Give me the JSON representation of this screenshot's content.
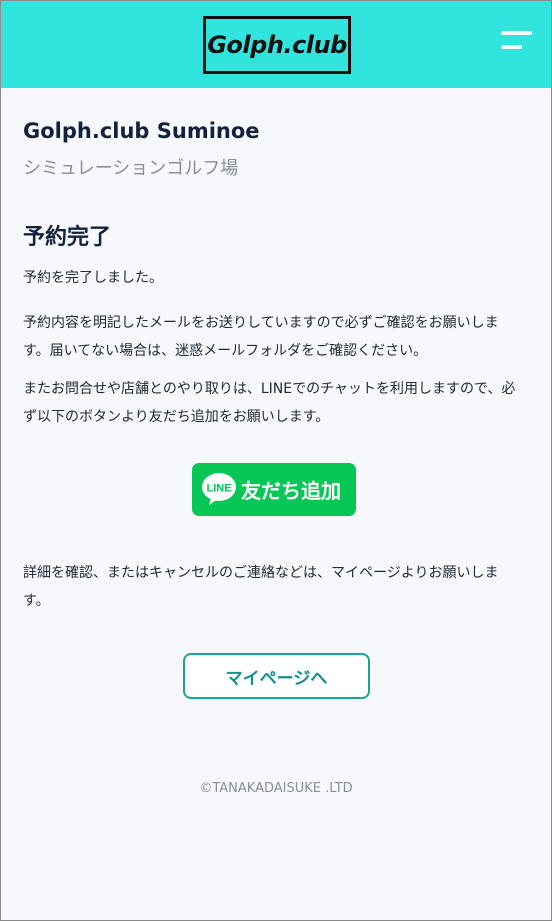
{
  "header": {
    "logo_text": "Golph.club",
    "menu_icon": "hamburger-menu-icon",
    "background_color": "#32e4de"
  },
  "store": {
    "name": "Golph.club Suminoe",
    "type": "シミュレーションゴルフ場"
  },
  "main": {
    "heading": "予約完了",
    "paragraph1": "予約を完了しました。",
    "paragraph2": "予約内容を明記したメールをお送りしていますので必ずご確認をお願いします。届いてない場合は、迷惑メールフォルダをご確認ください。",
    "paragraph3": "またお問合せや店舗とのやり取りは、LINEでのチャットを利用しますので、必ず以下のボタンより友だち追加をお願いします。",
    "line_button": {
      "icon_text": "LINE",
      "label": "友だち追加",
      "color": "#06c755"
    },
    "paragraph4": "詳細を確認、またはキャンセルのご連絡などは、マイページよりお願いします。",
    "mypage_button_label": "マイページへ"
  },
  "footer": {
    "copyright": "©TANAKADAISUKE .LTD"
  }
}
